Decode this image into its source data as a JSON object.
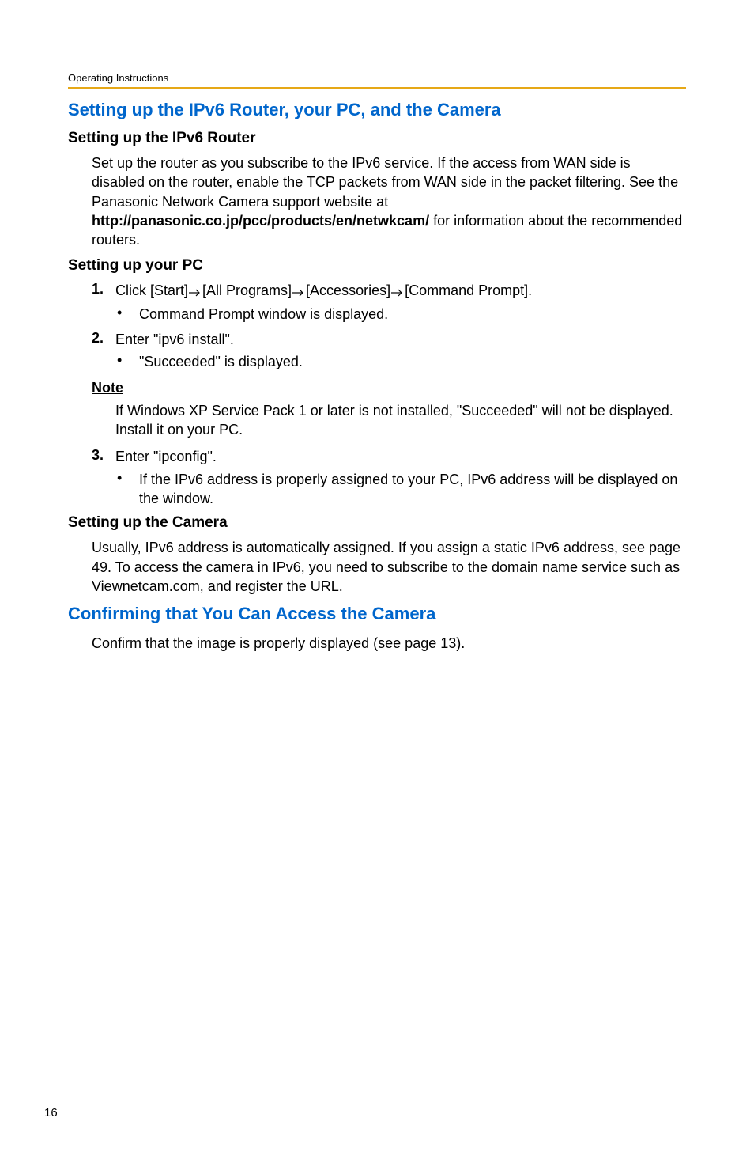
{
  "header": "Operating Instructions",
  "section1": {
    "title": "Setting up the IPv6 Router, your PC, and the Camera",
    "sub1": {
      "title": "Setting up the IPv6 Router",
      "text_pre": "Set up the router as you subscribe to the IPv6 service. If the access from WAN side is disabled on the router, enable the TCP packets from WAN side in the packet filtering. See the Panasonic Network Camera support website at ",
      "text_bold": "http://panasonic.co.jp/pcc/products/en/netwkcam/",
      "text_post": " for information about the recommended routers."
    },
    "sub2": {
      "title": "Setting up your PC",
      "step1_num": "1.",
      "step1_pre": "Click [Start]",
      "step1_p2": "[All Programs]",
      "step1_p3": "[Accessories]",
      "step1_p4": "[Command Prompt].",
      "step1_bullet": "Command Prompt window is displayed.",
      "step2_num": "2.",
      "step2_text": "Enter \"ipv6 install\".",
      "step2_bullet": "\"Succeeded\" is displayed.",
      "note_title": "Note",
      "note_text": "If Windows XP Service Pack 1 or later is not installed, \"Succeeded\" will not be displayed. Install it on your PC.",
      "step3_num": "3.",
      "step3_text": "Enter \"ipconfig\".",
      "step3_bullet": "If the IPv6 address is properly assigned to your PC, IPv6 address will be displayed on the window."
    },
    "sub3": {
      "title": "Setting up the Camera",
      "text": "Usually, IPv6 address is automatically assigned. If you assign a static IPv6 address, see page 49. To access the camera in IPv6, you need to subscribe to the domain name service such as Viewnetcam.com, and register the URL."
    }
  },
  "section2": {
    "title": "Confirming that You Can Access the Camera",
    "text": "Confirm that the image is properly displayed (see page 13)."
  },
  "pageNumber": "16"
}
